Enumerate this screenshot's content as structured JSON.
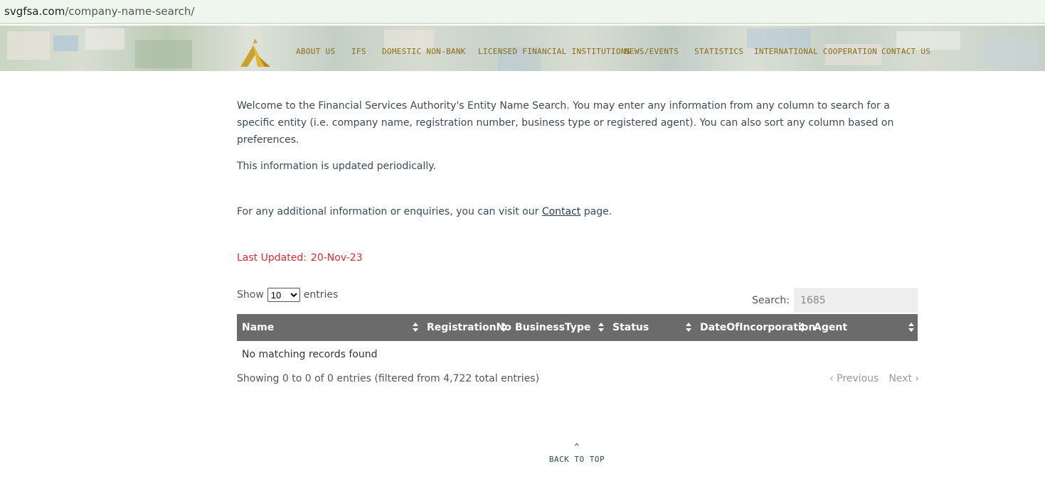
{
  "browser": {
    "url_domain": "svgfsa.com",
    "url_path": "/company-name-search/"
  },
  "nav": {
    "items": [
      "ABOUT US",
      "IFS",
      "DOMESTIC NON-BANK",
      "LICENSED FINANCIAL INSTITUTIONS",
      "NEWS/EVENTS",
      "STATISTICS",
      "INTERNATIONAL COOPERATION",
      "CONTACT US"
    ]
  },
  "intro": {
    "paragraph1": "Welcome to the Financial Services Authority's Entity Name Search. You may enter any information from any column to search for a specific entity (i.e. company name, registration number, business type or registered agent). You can also sort any column based on preferences.",
    "paragraph2": "This information is updated periodically.",
    "paragraph3_before": "For any additional information or enquiries, you can visit our ",
    "paragraph3_link": "Contact",
    "paragraph3_after": " page.",
    "last_updated_label": "Last Updated:",
    "last_updated_date": "20-Nov-23"
  },
  "table_controls": {
    "show_label": "Show",
    "show_value": "10",
    "entries_label": "entries",
    "search_label": "Search:",
    "search_value": "1685"
  },
  "table": {
    "columns": [
      "Name",
      "RegistrationNo",
      "BusinessType",
      "Status",
      "DateOfIncorporation",
      "Agent"
    ],
    "empty_message": "No matching records found"
  },
  "footer_info": {
    "showing_text": "Showing 0 to 0 of 0 entries (filtered from 4,722 total entries)",
    "previous_label": "Previous",
    "next_label": "Next",
    "back_to_top": "BACK TO TOP"
  }
}
